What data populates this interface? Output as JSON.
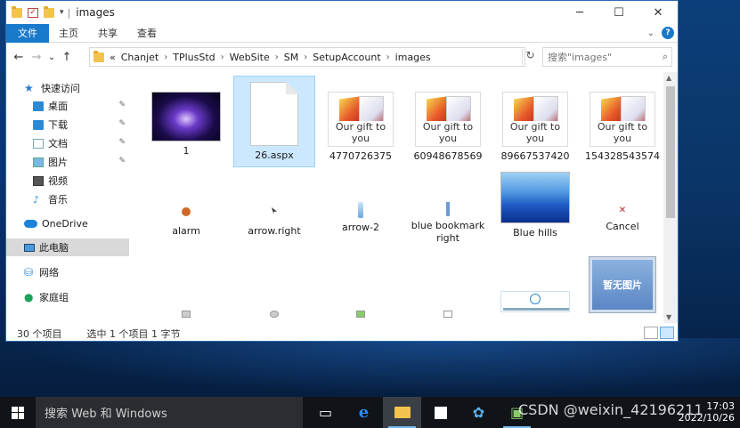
{
  "window": {
    "title": "images",
    "controls": {
      "minimize": "─",
      "maximize": "☐",
      "close": "✕"
    }
  },
  "ribbon": {
    "file_tab": "文件",
    "tabs": [
      "主页",
      "共享",
      "查看"
    ],
    "collapse_glyph": "⌄",
    "help": "?"
  },
  "address": {
    "back": "←",
    "forward": "→",
    "recent": "⌄",
    "up": "↑",
    "prefix": "«",
    "crumbs": [
      "Chanjet",
      "TPlusStd",
      "WebSite",
      "SM",
      "SetupAccount",
      "images"
    ],
    "separator": "›",
    "refresh": "↻",
    "search_placeholder": "搜索\"images\"",
    "search_icon": "⌕"
  },
  "sidebar": {
    "quick_access": "快速访问",
    "items": [
      {
        "label": "桌面",
        "icon": "desktop-icon",
        "pinned": true
      },
      {
        "label": "下载",
        "icon": "download-icon",
        "pinned": true
      },
      {
        "label": "文档",
        "icon": "document-icon",
        "pinned": true
      },
      {
        "label": "图片",
        "icon": "pictures-icon",
        "pinned": true
      },
      {
        "label": "视频",
        "icon": "video-icon",
        "pinned": false
      },
      {
        "label": "音乐",
        "icon": "music-icon",
        "pinned": false
      }
    ],
    "onedrive": "OneDrive",
    "this_pc": "此电脑",
    "network": "网络",
    "homegroup": "家庭组",
    "pin_glyph": "📌"
  },
  "files": {
    "row1": [
      {
        "name": "1",
        "thumb": "lotus"
      },
      {
        "name": "26.aspx",
        "thumb": "document",
        "selected": true
      },
      {
        "name": "4770726375",
        "thumb": "gift"
      },
      {
        "name": "60948678569",
        "thumb": "gift"
      },
      {
        "name": "89667537420",
        "thumb": "gift"
      },
      {
        "name": "154328543574",
        "thumb": "gift"
      }
    ],
    "gift_caption": "Our gift to you",
    "row2": [
      {
        "name": "alarm"
      },
      {
        "name": "arrow.right"
      },
      {
        "name": "arrow-2"
      },
      {
        "name": "blue bookmark right"
      },
      {
        "name": "Blue hills"
      },
      {
        "name": "Cancel"
      }
    ],
    "nopic_text": "暂无图片"
  },
  "status": {
    "count": "30 个项目",
    "selection": "选中 1 个项目  1 字节"
  },
  "taskbar": {
    "search_placeholder": "搜索 Web 和 Windows",
    "time": "17:03",
    "date": "2022/10/26",
    "watermark": "CSDN @weixin_42196211"
  }
}
